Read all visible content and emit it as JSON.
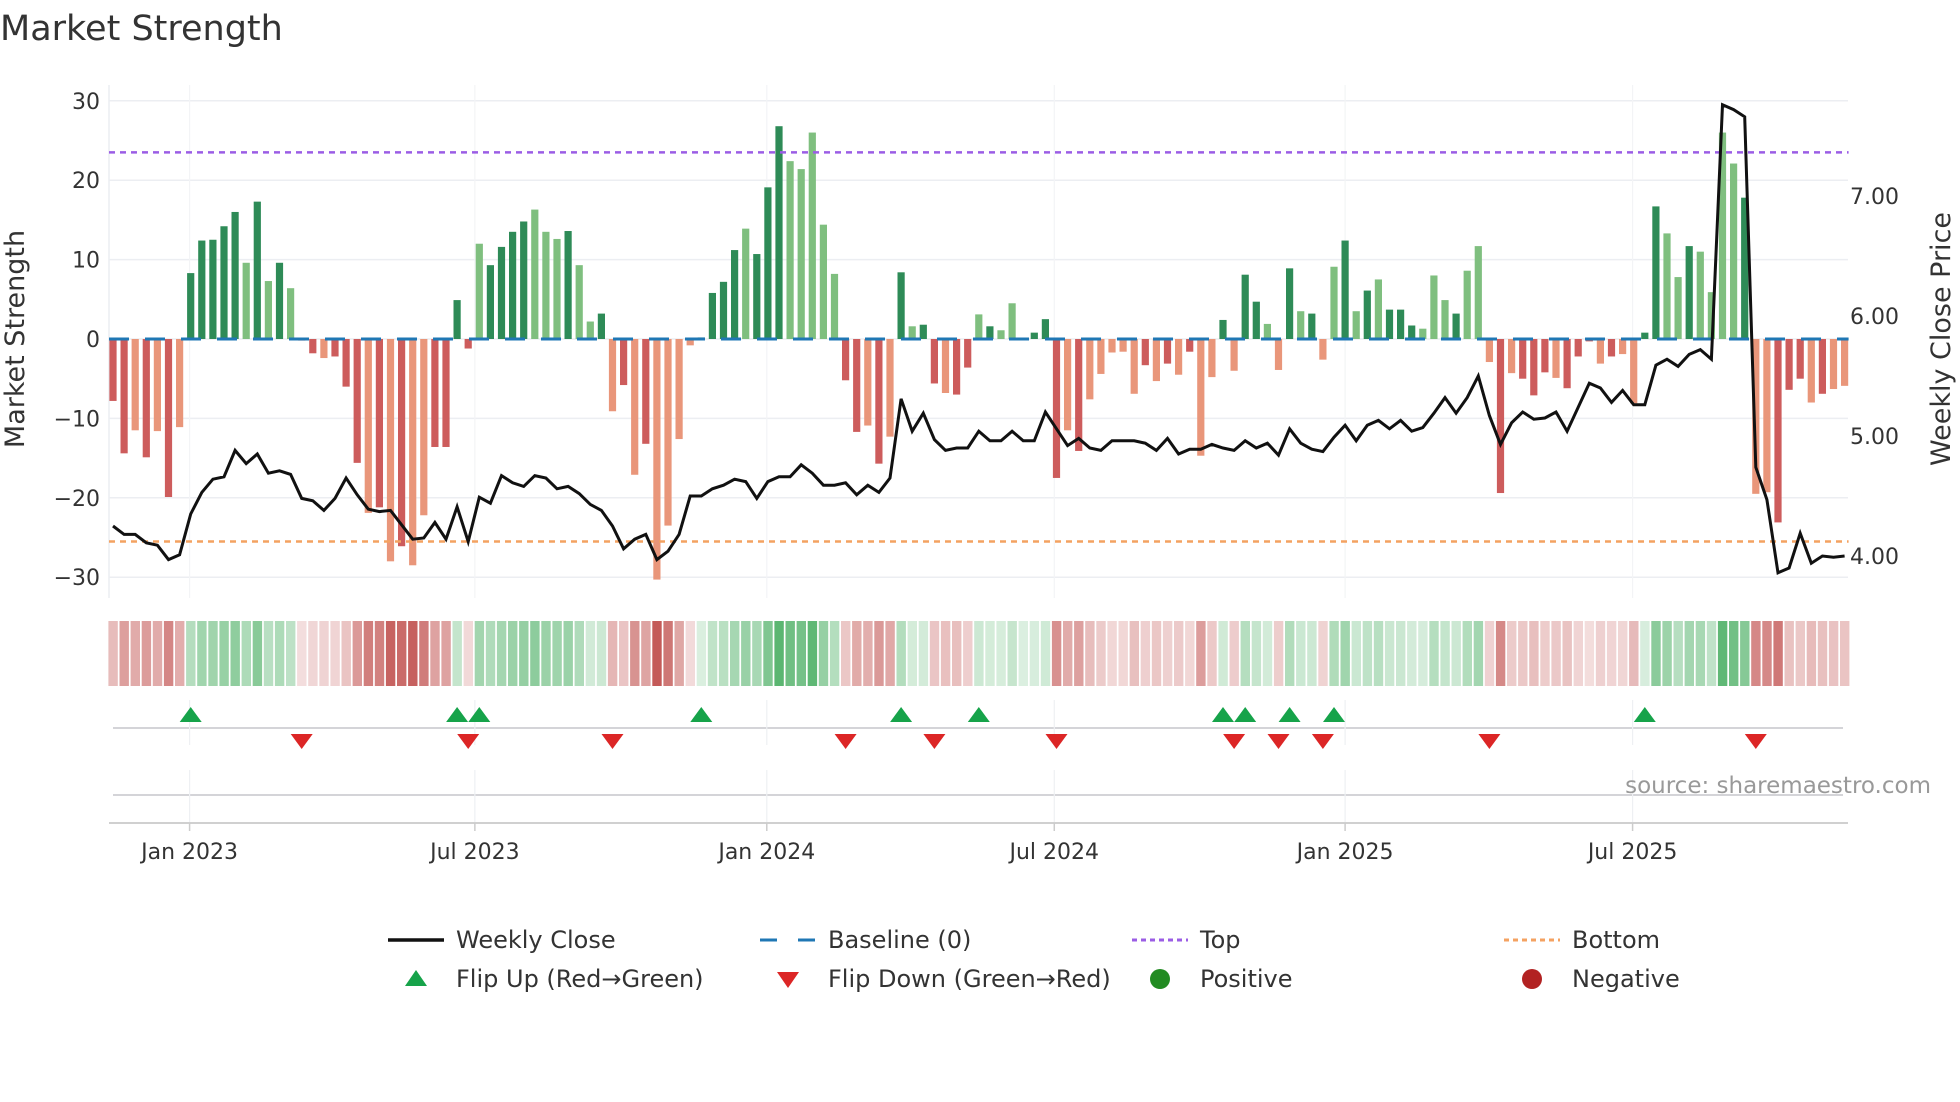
{
  "chart_data": {
    "type": "bar",
    "title": "Market Strength",
    "ylabel": "Market Strength",
    "y2label": "Weekly Close Price",
    "ylim": [
      -32,
      33
    ],
    "y2lim": [
      3.78,
      7.98
    ],
    "yticks": [
      30,
      20,
      10,
      0,
      -10,
      -20,
      -30
    ],
    "yticklabels": [
      "30",
      "20",
      "10",
      "0",
      "−10",
      "−20",
      "−30"
    ],
    "y2ticks": [
      7,
      6,
      5,
      4
    ],
    "y2ticklabels": [
      "7.00",
      "6.00",
      "5.00",
      "4.00"
    ],
    "top_level": 23.5,
    "bottom_level": -25.5,
    "baseline": 0,
    "x_unit": "week index",
    "xticks": [
      {
        "pos": 6.9,
        "label": "Jan 2023"
      },
      {
        "pos": 32.6,
        "label": "Jul 2023"
      },
      {
        "pos": 58.9,
        "label": "Jan 2024"
      },
      {
        "pos": 84.8,
        "label": "Jul 2024"
      },
      {
        "pos": 111.0,
        "label": "Jan 2025"
      },
      {
        "pos": 136.9,
        "label": "Jul 2025"
      }
    ],
    "strength": [
      -7.8,
      -14.4,
      -11.5,
      -14.9,
      -11.6,
      -19.9,
      -11.1,
      8.3,
      12.4,
      12.5,
      14.2,
      16.0,
      9.6,
      17.3,
      7.3,
      9.6,
      6.4,
      -0.2,
      -1.8,
      -2.4,
      -2.2,
      -6.0,
      -15.6,
      -21.9,
      -21.2,
      -28.0,
      -26.1,
      -28.5,
      -22.2,
      -13.6,
      -13.6,
      4.9,
      -1.2,
      12.0,
      9.3,
      11.6,
      13.5,
      14.8,
      16.3,
      13.5,
      12.6,
      13.6,
      9.3,
      2.2,
      3.2,
      -9.1,
      -5.8,
      -17.1,
      -13.2,
      -30.3,
      -23.5,
      -12.6,
      -0.8,
      0.2,
      5.8,
      7.2,
      11.2,
      13.9,
      10.7,
      19.1,
      26.8,
      22.4,
      21.4,
      26.0,
      14.4,
      8.2,
      -5.2,
      -11.7,
      -10.9,
      -15.7,
      -12.3,
      8.4,
      1.6,
      1.8,
      -5.6,
      -6.8,
      -7.0,
      -3.6,
      3.1,
      1.6,
      1.1,
      4.5,
      0.1,
      0.8,
      2.5,
      -17.5,
      -11.5,
      -14.1,
      -7.6,
      -4.4,
      -1.7,
      -1.6,
      -6.9,
      -3.3,
      -5.3,
      -3.1,
      -4.5,
      -1.6,
      -14.7,
      -4.8,
      2.4,
      -4.0,
      8.1,
      4.7,
      1.9,
      -3.9,
      8.9,
      3.5,
      3.2,
      -2.6,
      9.1,
      12.4,
      3.5,
      6.1,
      7.5,
      3.7,
      3.7,
      1.7,
      1.3,
      8.0,
      4.9,
      3.2,
      8.6,
      11.7,
      -2.9,
      -19.4,
      -4.3,
      -5.0,
      -7.1,
      -4.2,
      -4.9,
      -6.2,
      -2.2,
      -0.3,
      -3.1,
      -2.2,
      -1.9,
      -8.1,
      0.8,
      16.7,
      13.3,
      7.8,
      11.7,
      11.0,
      5.9,
      26.0,
      22.1,
      17.8,
      -19.5,
      -19.3,
      -23.1,
      -6.4,
      -5.0,
      -8.0,
      -6.9,
      -6.3,
      -5.9
    ],
    "shade": "ddldldldddddldldlddldddldldllddddlddddllldlldldldllllddddldddlllllddldldlddlddldllddddldllllldldldlldlddlldldlldldldddllldllldldddldddldllddlldlllldlldddldlldlldll",
    "close": [
      4.25,
      4.18,
      4.18,
      4.11,
      4.09,
      3.97,
      4.01,
      4.35,
      4.53,
      4.64,
      4.66,
      4.88,
      4.77,
      4.85,
      4.69,
      4.71,
      4.68,
      4.48,
      4.46,
      4.38,
      4.48,
      4.65,
      4.51,
      4.39,
      4.37,
      4.38,
      4.26,
      4.14,
      4.15,
      4.28,
      4.14,
      4.41,
      4.12,
      4.49,
      4.44,
      4.67,
      4.61,
      4.58,
      4.67,
      4.65,
      4.56,
      4.58,
      4.52,
      4.43,
      4.38,
      4.25,
      4.06,
      4.14,
      4.18,
      3.97,
      4.04,
      4.18,
      4.5,
      4.5,
      4.56,
      4.59,
      4.64,
      4.62,
      4.48,
      4.62,
      4.66,
      4.66,
      4.76,
      4.69,
      4.59,
      4.59,
      4.61,
      4.51,
      4.59,
      4.53,
      4.65,
      5.31,
      5.04,
      5.19,
      4.97,
      4.88,
      4.9,
      4.9,
      5.04,
      4.96,
      4.96,
      5.04,
      4.96,
      4.96,
      5.2,
      5.06,
      4.92,
      4.98,
      4.9,
      4.88,
      4.96,
      4.96,
      4.96,
      4.94,
      4.88,
      4.98,
      4.85,
      4.89,
      4.89,
      4.93,
      4.9,
      4.88,
      4.96,
      4.9,
      4.94,
      4.84,
      5.06,
      4.94,
      4.89,
      4.87,
      4.99,
      5.09,
      4.96,
      5.09,
      5.13,
      5.06,
      5.13,
      5.04,
      5.07,
      5.19,
      5.32,
      5.19,
      5.32,
      5.5,
      5.17,
      4.93,
      5.11,
      5.2,
      5.14,
      5.15,
      5.2,
      5.04,
      5.24,
      5.44,
      5.4,
      5.28,
      5.38,
      5.26,
      5.26,
      5.59,
      5.64,
      5.58,
      5.68,
      5.72,
      5.64,
      7.76,
      7.72,
      7.66,
      4.74,
      4.47,
      3.86,
      3.9,
      4.19,
      3.94,
      4.0,
      3.99,
      4.0
    ],
    "legend": {
      "placement": "bottom",
      "items": [
        {
          "label": "Weekly Close",
          "symbol": "line-solid",
          "color": "#111111"
        },
        {
          "label": "Baseline (0)",
          "symbol": "line-dashed",
          "color": "#1f77b4"
        },
        {
          "label": "Top",
          "symbol": "line-dotted",
          "color": "#9b5de5"
        },
        {
          "label": "Bottom",
          "symbol": "line-dotted",
          "color": "#f4a261"
        },
        {
          "label": "Flip Up (Red→Green)",
          "symbol": "triangle-up",
          "color": "#16a34a"
        },
        {
          "label": "Flip Down (Green→Red)",
          "symbol": "triangle-down",
          "color": "#dc2626"
        },
        {
          "label": "Positive",
          "symbol": "circle",
          "color": "#228b22"
        },
        {
          "label": "Negative",
          "symbol": "circle",
          "color": "#b22222"
        }
      ]
    },
    "source": "source: sharemaestro.com",
    "colors": {
      "pos_dark": "#2e8b57",
      "pos_light": "#7fbf7f",
      "neg_dark": "#cd5c5c",
      "neg_light": "#e9967a",
      "baseline": "#1f77b4",
      "top": "#9b5de5",
      "bottom": "#f4a261",
      "flip_up": "#16a34a",
      "flip_down": "#dc2626"
    }
  }
}
